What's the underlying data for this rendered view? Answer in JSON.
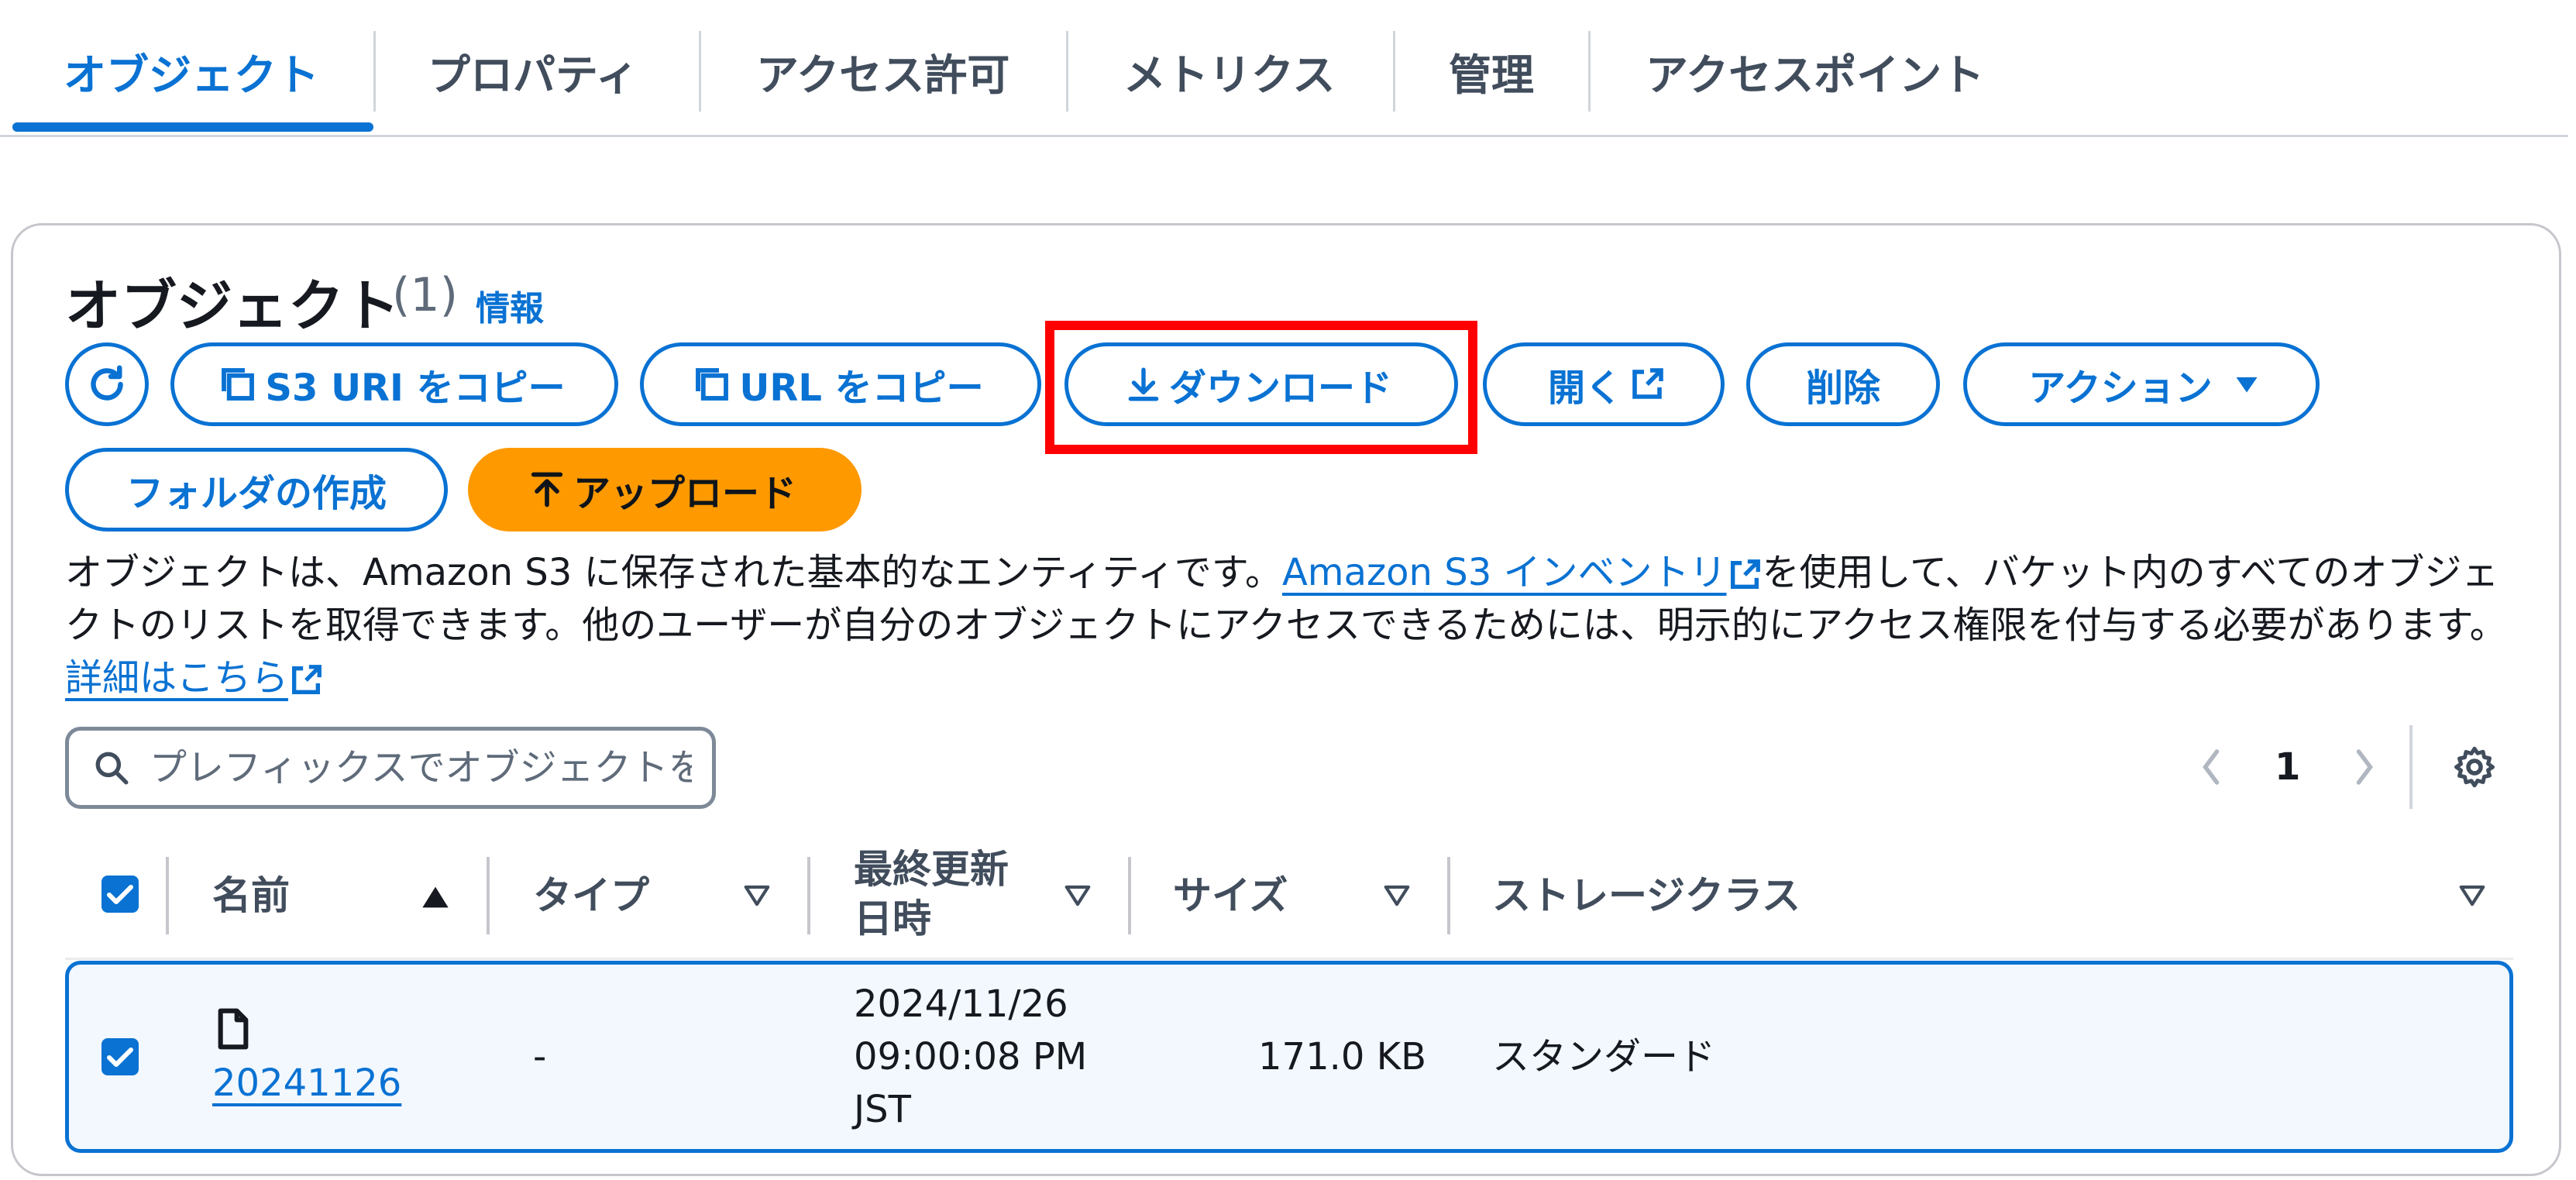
{
  "tabs": [
    {
      "label": "オブジェクト",
      "active": true
    },
    {
      "label": "プロパティ"
    },
    {
      "label": "アクセス許可"
    },
    {
      "label": "メトリクス"
    },
    {
      "label": "管理"
    },
    {
      "label": "アクセスポイント"
    }
  ],
  "header": {
    "title": "オブジェクト",
    "count": "(1)",
    "info": "情報"
  },
  "toolbar": {
    "refresh_icon": "refresh-icon",
    "copy_s3_uri": "S3 URI をコピー",
    "copy_url": "URL をコピー",
    "download": "ダウンロード",
    "open": "開く",
    "delete": "削除",
    "actions": "アクション",
    "create_folder": "フォルダの作成",
    "upload": "アップロード"
  },
  "description": {
    "text1": "オブジェクトは、Amazon S3 に保存された基本的なエンティティです。",
    "link1": "Amazon S3 インベントリ",
    "text2": "を使用して、バケット内のすべてのオブジェクトのリストを取得できます。他のユーザーが自分のオブジェクトにアクセスできるためには、明示的にアクセス権限を付与する必要があります。",
    "link2": "詳細はこちら"
  },
  "search": {
    "placeholder": "プレフィックスでオブジェクトを検索"
  },
  "pagination": {
    "current": "1"
  },
  "table": {
    "headers": {
      "name": "名前",
      "type": "タイプ",
      "modified_line1": "最終更新",
      "modified_line2": "日時",
      "size": "サイズ",
      "storage_class": "ストレージクラス"
    },
    "rows": [
      {
        "name": "20241126",
        "type": "-",
        "modified_line1": "2024/11/26",
        "modified_line2": "09:00:08 PM",
        "modified_line3": "JST",
        "size": "171.0 KB",
        "storage_class": "スタンダード",
        "selected": true
      }
    ]
  },
  "colors": {
    "accent": "#0972d3",
    "primary_button": "#ff9900",
    "highlight": "#ff0000"
  }
}
